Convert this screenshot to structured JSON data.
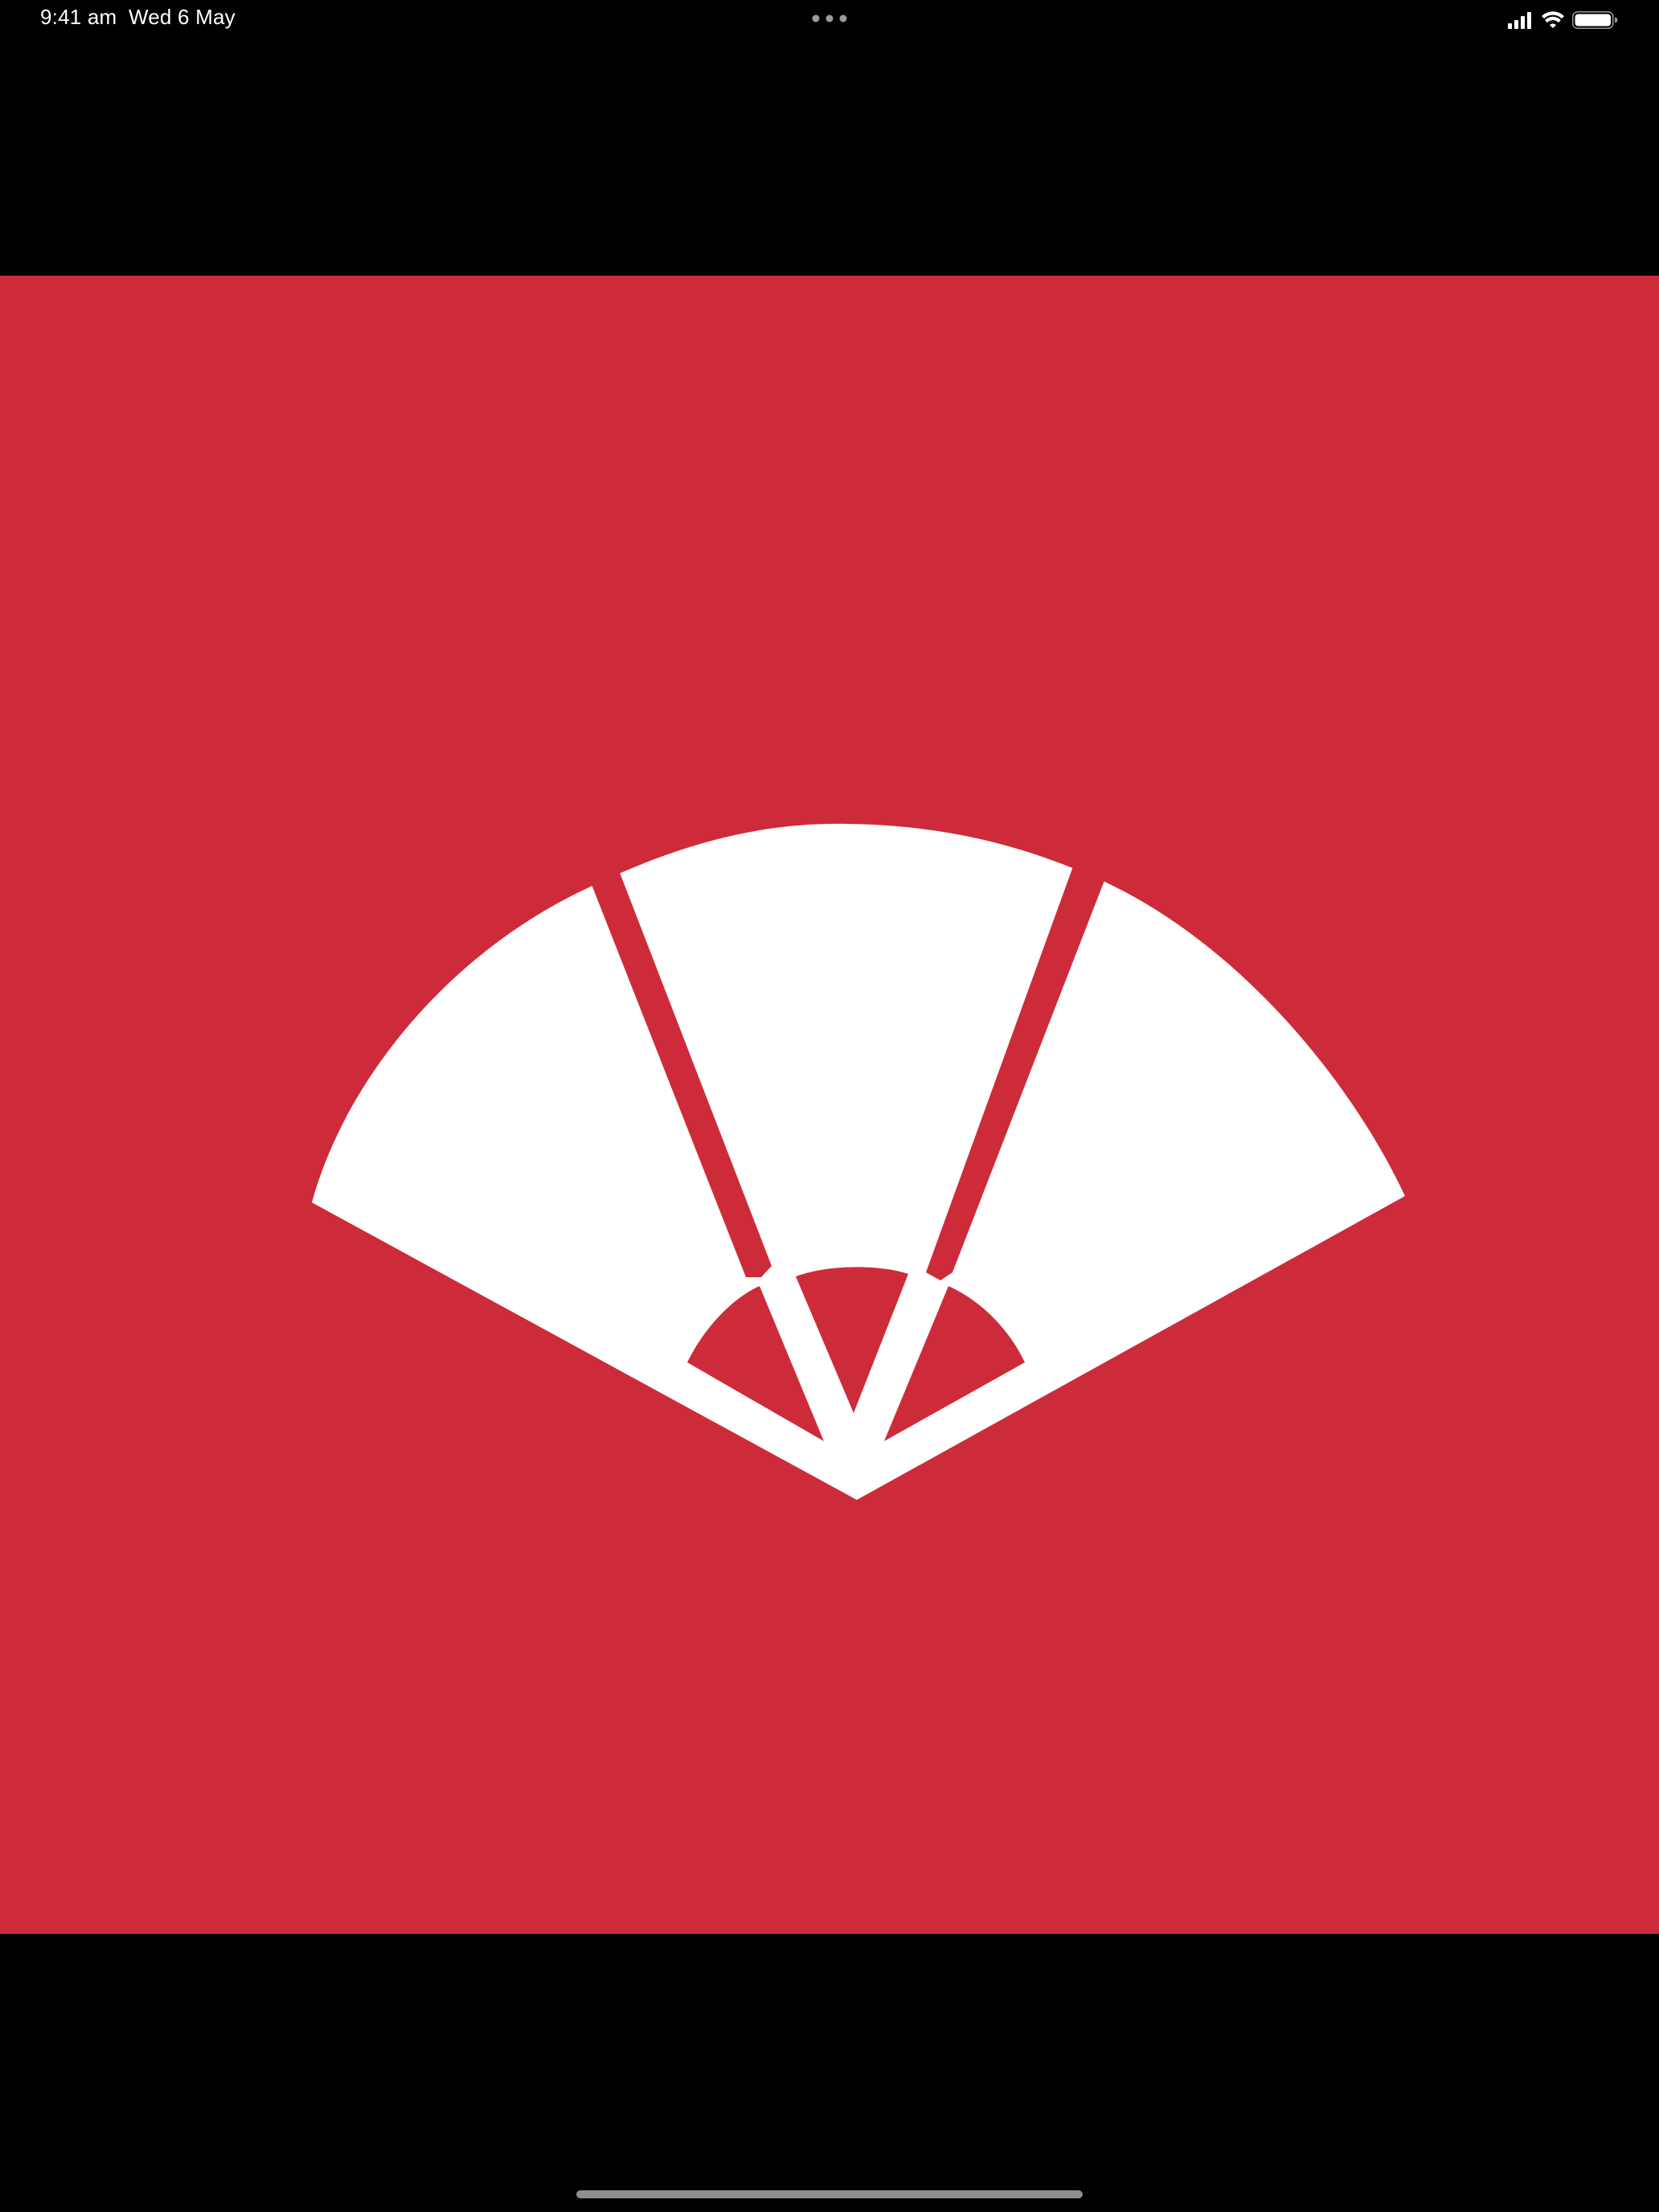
{
  "status_bar": {
    "time": "9:41 am",
    "date": "Wed 6 May",
    "icons": [
      "cellular-signal-icon",
      "wifi-icon",
      "battery-icon"
    ],
    "multitasking_indicator": "ellipsis-icon"
  },
  "app_view": {
    "graphic": "folding-fan-icon",
    "background_color": "#ce2b3a",
    "graphic_color": "#ffffff"
  },
  "home_indicator": "home-indicator-bar"
}
